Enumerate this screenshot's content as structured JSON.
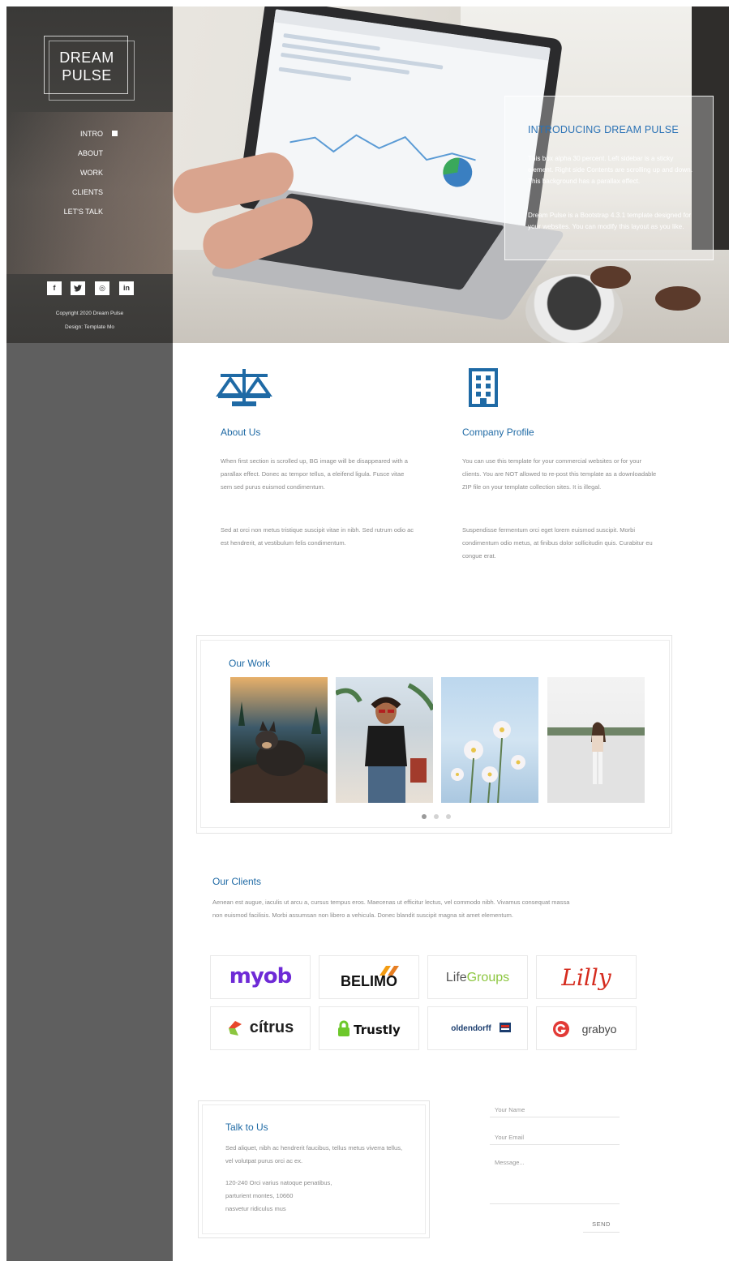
{
  "brand": {
    "line1": "DREAM",
    "line2": "PULSE"
  },
  "nav": [
    {
      "label": "INTRO",
      "active": true
    },
    {
      "label": "ABOUT",
      "active": false
    },
    {
      "label": "WORK",
      "active": false
    },
    {
      "label": "CLIENTS",
      "active": false
    },
    {
      "label": "LET'S TALK",
      "active": false
    }
  ],
  "social": [
    {
      "icon": "facebook-icon",
      "glyph": "f"
    },
    {
      "icon": "twitter-icon",
      "glyph": "t"
    },
    {
      "icon": "dribbble-icon",
      "glyph": "◎"
    },
    {
      "icon": "linkedin-icon",
      "glyph": "in"
    }
  ],
  "footer": {
    "copyright": "Copyright 2020 Dream Pulse",
    "design": "Design: Template Mo"
  },
  "intro": {
    "title": "INTRODUCING DREAM PULSE",
    "p1": "This box alpha 30 percent. Left sidebar is a sticky element. Right side Contents are scrolling up and down. This background has a parallax effect.",
    "p2": "Dream Pulse is a Bootstrap 4.3.1 template designed for your websites. You can modify this layout as you like."
  },
  "about": {
    "icon": "scales-icon",
    "title": "About Us",
    "p1": "When first section is scrolled up, BG image will be disappeared with a parallax effect. Donec ac tempor tellus, a eleifend ligula. Fusce vitae sem sed purus euismod condimentum.",
    "p2": "Sed at orci non metus tristique suscipit vitae in nibh. Sed rutrum odio ac est hendrerit, at vestibulum felis condimentum."
  },
  "profile": {
    "icon": "building-icon",
    "title": "Company Profile",
    "p1": "You can use this template for your commercial websites or for your clients. You are NOT allowed to re-post this template as a downloadable ZIP file on your template collection sites. It is illegal.",
    "p2": "Suspendisse fermentum orci eget lorem euismod suscipit. Morbi condimentum odio metus, at finibus dolor sollicitudin quis. Curabitur eu congue erat."
  },
  "work": {
    "title": "Our Work",
    "photos": [
      "dog-photo",
      "woman-sunglasses-photo",
      "flowers-photo",
      "woman-rooftop-photo"
    ],
    "dots": 3,
    "active_dot": 0
  },
  "clients": {
    "title": "Our Clients",
    "text": "Aenean est augue, iaculis ut arcu a, cursus tempus eros. Maecenas ut efficitur lectus, vel commodo nibh. Vivamus consequat massa non euismod facilisis. Morbi assumsan non libero a vehicula. Donec blandit suscipit magna sit amet elementum.",
    "logos": [
      {
        "name": "myob",
        "text": "myob",
        "color": "#6e2ad6"
      },
      {
        "name": "belimo",
        "text": "BELIMO",
        "color": "#111111"
      },
      {
        "name": "lifegroups",
        "text_a": "Life",
        "text_b": "Groups",
        "color": "#555555",
        "accent": "#8cc63f"
      },
      {
        "name": "lilly",
        "text": "Lilly",
        "color": "#d52b1e"
      },
      {
        "name": "citrus",
        "text": "cítrus",
        "color": "#222222",
        "accent": "#e8462b"
      },
      {
        "name": "trustly",
        "text": "Trustly",
        "color": "#111111",
        "accent": "#6dc82b"
      },
      {
        "name": "oldendorff",
        "text": "oldendorff",
        "color": "#1b3d6e"
      },
      {
        "name": "grabyo",
        "text": "grabyo",
        "color": "#444444",
        "accent": "#e23a36"
      }
    ]
  },
  "contact": {
    "title": "Talk to Us",
    "text": "Sed aliquet, nibh ac hendrerit faucibus, tellus metus viverra tellus, vel volutpat purus orci ac ex.",
    "address1": "120-240 Orci varius natoque penatibus,",
    "address2": "parturient montes, 10660",
    "address3": "nasvetur ridiculus mus",
    "name_placeholder": "Your Name",
    "email_placeholder": "Your Email",
    "message_placeholder": "Message...",
    "send_label": "SEND"
  }
}
